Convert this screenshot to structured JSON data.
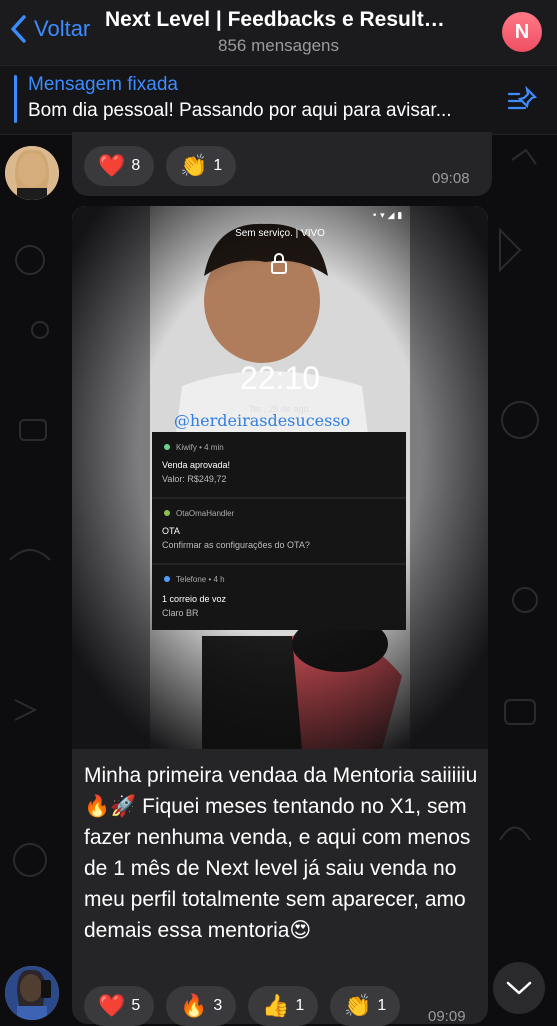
{
  "header": {
    "back_label": "Voltar",
    "title": "Next Level | Feedbacks e Resultados",
    "subtitle": "856 mensagens",
    "avatar_letter": "N"
  },
  "pinned": {
    "title": "Mensagem fixada",
    "text": "Bom dia pessoal! Passando por aqui para avisar..."
  },
  "message1": {
    "reactions": [
      {
        "emoji": "❤️",
        "count": "8"
      },
      {
        "emoji": "👏",
        "count": "1"
      }
    ],
    "time": "09:08"
  },
  "message2": {
    "phone": {
      "status": "Sem serviço. | VIVO",
      "clock": "22:10",
      "date": "Ter., 29 de ago.",
      "watermark": "@herdeirasdesucesso",
      "notifications": [
        {
          "app": "Kiwify • 4 min",
          "title": "Venda aprovada!",
          "body": "Valor: R$249,72"
        },
        {
          "app": "OtaOmaHandler",
          "title": "OTA",
          "body": "Confirmar as configurações do OTA?"
        },
        {
          "app": "Telefone • 4 h",
          "title": "1 correio de voz",
          "body": "Claro BR"
        }
      ]
    },
    "caption": "Minha primeira vendaa da Mentoria saiiiiiu 🔥🚀 Fiquei meses tentando no X1, sem fazer nenhuma venda, e aqui com menos de 1 mês de Next level já saiu venda no meu perfil totalmente sem aparecer, amo demais essa mentoria😍",
    "reactions": [
      {
        "emoji": "❤️",
        "count": "5"
      },
      {
        "emoji": "🔥",
        "count": "3"
      },
      {
        "emoji": "👍",
        "count": "1"
      },
      {
        "emoji": "👏",
        "count": "1"
      }
    ],
    "time": "09:09"
  },
  "colors": {
    "accent": "#3c8cff",
    "bubble": "#252527",
    "background": "#0d0d0f"
  }
}
